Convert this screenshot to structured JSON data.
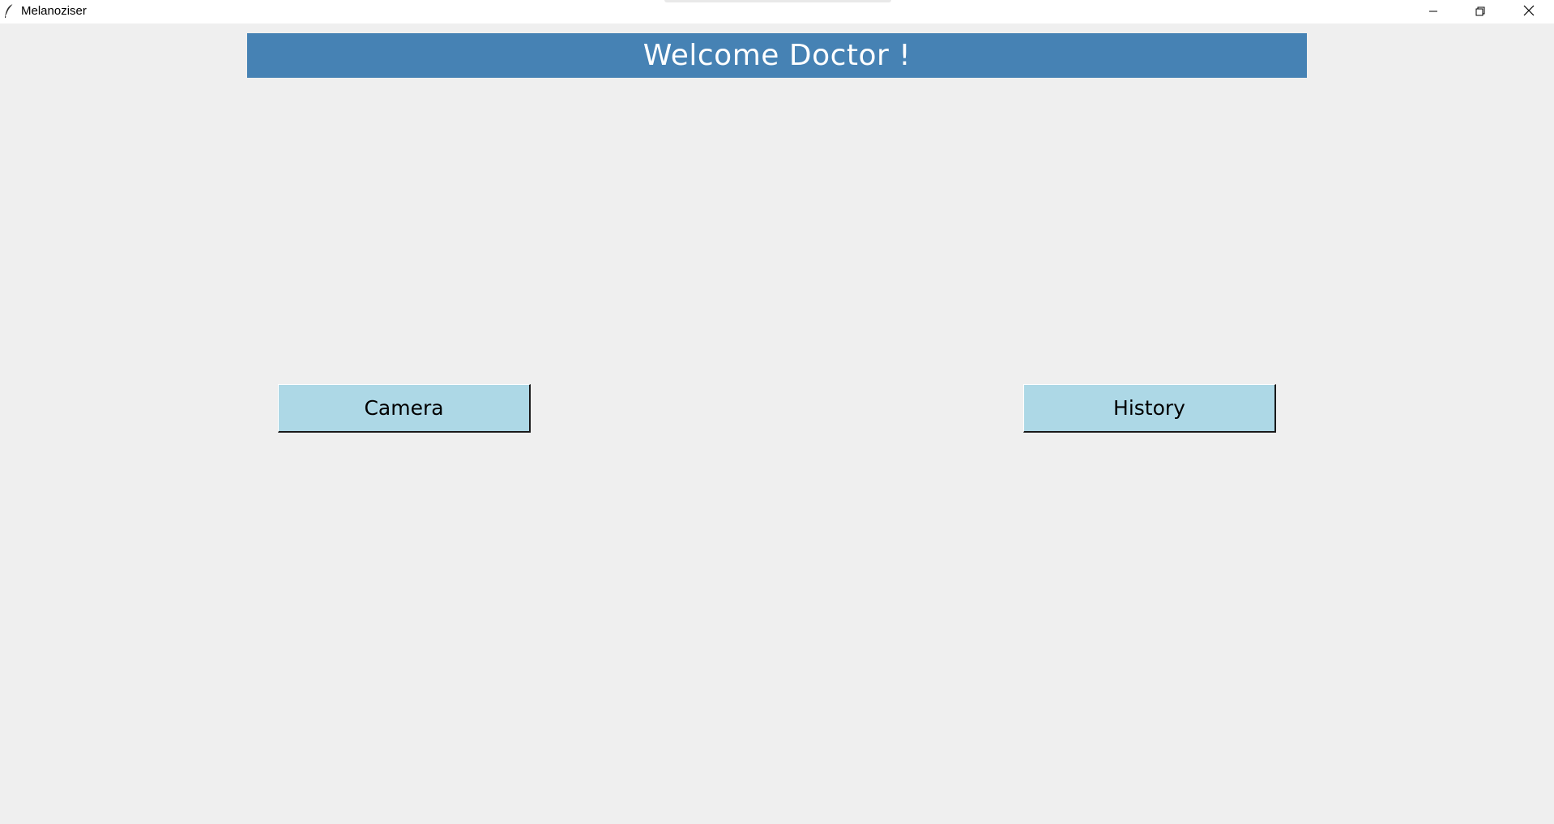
{
  "window": {
    "title": "Melanoziser",
    "app_icon": "feather-icon",
    "controls": {
      "minimize_icon": "minimize-icon",
      "maximize_icon": "restore-icon",
      "close_icon": "close-icon"
    }
  },
  "header": {
    "text": "Welcome Doctor !"
  },
  "buttons": {
    "camera_label": "Camera",
    "history_label": "History"
  },
  "colors": {
    "background": "#efefef",
    "header_bg": "#4682b4",
    "header_text": "#ffffff",
    "button_bg": "#add8e6"
  }
}
